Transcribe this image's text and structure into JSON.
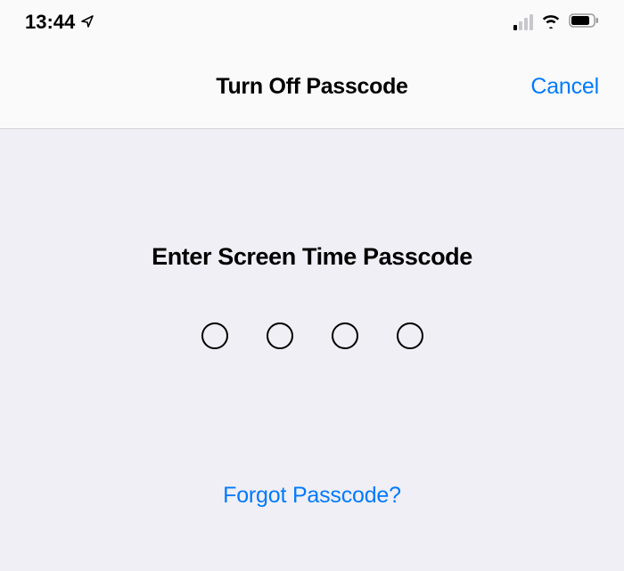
{
  "status_bar": {
    "time": "13:44"
  },
  "nav": {
    "title": "Turn Off Passcode",
    "cancel": "Cancel"
  },
  "content": {
    "prompt": "Enter Screen Time Passcode",
    "forgot": "Forgot Passcode?"
  }
}
